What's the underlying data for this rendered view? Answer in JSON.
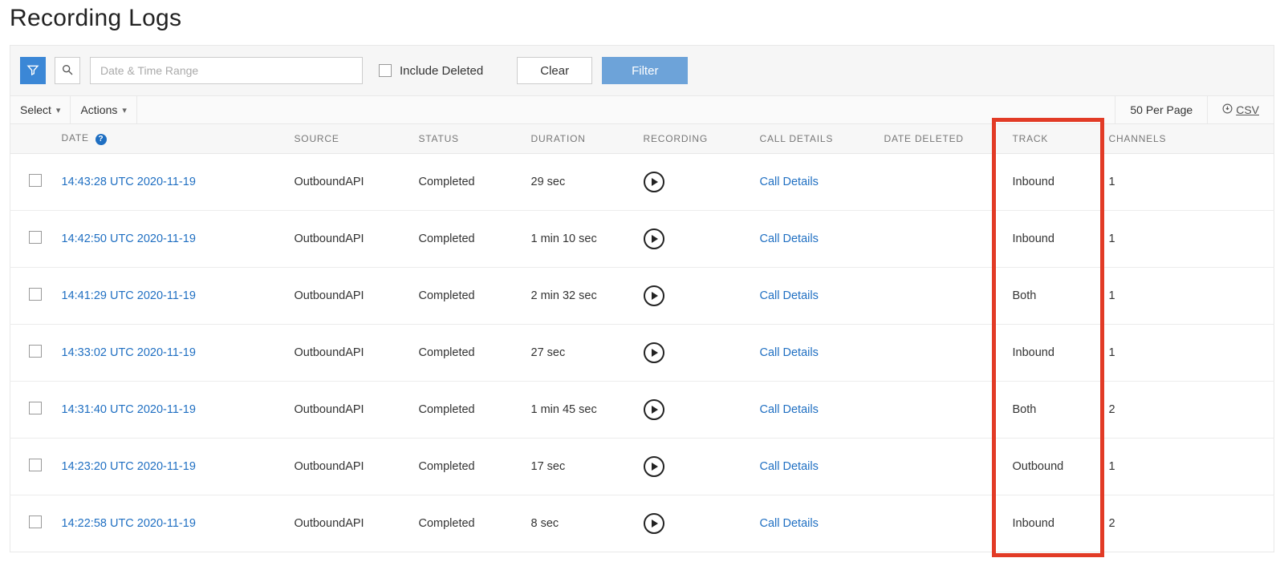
{
  "page": {
    "title": "Recording Logs"
  },
  "filter": {
    "date_placeholder": "Date & Time Range",
    "include_deleted_label": "Include Deleted",
    "clear_label": "Clear",
    "filter_label": "Filter"
  },
  "secondary": {
    "select_label": "Select",
    "actions_label": "Actions",
    "per_page_label": "50 Per Page",
    "csv_label": "CSV"
  },
  "columns": {
    "date": "DATE",
    "source": "SOURCE",
    "status": "STATUS",
    "duration": "DURATION",
    "recording": "RECORDING",
    "call_details": "CALL DETAILS",
    "date_deleted": "DATE DELETED",
    "track": "TRACK",
    "channels": "CHANNELS"
  },
  "row_common": {
    "call_details_link": "Call Details"
  },
  "rows": [
    {
      "date": "14:43:28 UTC 2020-11-19",
      "source": "OutboundAPI",
      "status": "Completed",
      "duration": "29 sec",
      "date_deleted": "",
      "track": "Inbound",
      "channels": "1"
    },
    {
      "date": "14:42:50 UTC 2020-11-19",
      "source": "OutboundAPI",
      "status": "Completed",
      "duration": "1 min 10 sec",
      "date_deleted": "",
      "track": "Inbound",
      "channels": "1"
    },
    {
      "date": "14:41:29 UTC 2020-11-19",
      "source": "OutboundAPI",
      "status": "Completed",
      "duration": "2 min 32 sec",
      "date_deleted": "",
      "track": "Both",
      "channels": "1"
    },
    {
      "date": "14:33:02 UTC 2020-11-19",
      "source": "OutboundAPI",
      "status": "Completed",
      "duration": "27 sec",
      "date_deleted": "",
      "track": "Inbound",
      "channels": "1"
    },
    {
      "date": "14:31:40 UTC 2020-11-19",
      "source": "OutboundAPI",
      "status": "Completed",
      "duration": "1 min 45 sec",
      "date_deleted": "",
      "track": "Both",
      "channels": "2"
    },
    {
      "date": "14:23:20 UTC 2020-11-19",
      "source": "OutboundAPI",
      "status": "Completed",
      "duration": "17 sec",
      "date_deleted": "",
      "track": "Outbound",
      "channels": "1"
    },
    {
      "date": "14:22:58 UTC 2020-11-19",
      "source": "OutboundAPI",
      "status": "Completed",
      "duration": "8 sec",
      "date_deleted": "",
      "track": "Inbound",
      "channels": "2"
    }
  ],
  "highlight_column": "track",
  "colors": {
    "link": "#1f6fc2",
    "accent": "#3b87d6",
    "highlight_border": "#e23b26"
  }
}
